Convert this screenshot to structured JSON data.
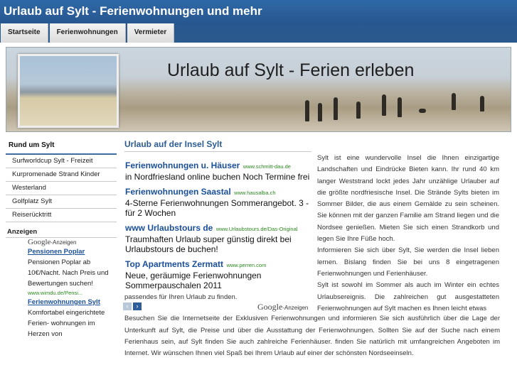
{
  "site": {
    "title": "Urlaub auf Sylt - Ferienwohnungen und mehr"
  },
  "nav": {
    "tabs": [
      "Startseite",
      "Ferienwohnungen",
      "Vermieter"
    ]
  },
  "banner": {
    "title": "Urlaub auf Sylt - Ferien erleben"
  },
  "sidebar": {
    "heading": "Rund um Sylt",
    "items": [
      "Surfworldcup Sylt - Freizeit",
      "Kurpromenade Strand Kinder",
      "Westerland",
      "Golfplatz Sylt",
      "Reiserücktritt"
    ],
    "ads_heading": "Anzeigen",
    "google_label": "-Anzeigen",
    "google_logo": "Google",
    "ads": [
      {
        "title": "Pensionen Poplar",
        "text": "Pensionen Poplar ab 10€/Nacht. Nach Preis und Bewertungen suchen!",
        "url": "www.wimdu.de/Pensi..."
      },
      {
        "title": "Ferienwohnungen Sylt",
        "text": "Komfortabel eingerichtete Ferien- wohnungen im Herzen von",
        "url": ""
      }
    ]
  },
  "main": {
    "title": "Urlaub auf der Insel Sylt",
    "ads": [
      {
        "title": "Ferienwohnungen u. Häuser",
        "url": "www.schmitt-dau.de",
        "text": "in Nordfriesland online buchen Noch Termine frei"
      },
      {
        "title": "Ferienwohnungen Saastal",
        "url": "www.hausalba.ch",
        "text": "4-Sterne Ferienwohnungen Sommerangebot. 3 - für 2 Wochen"
      },
      {
        "title": "www Urlaubstours de",
        "url": "www.Urlaubstours.de/Das-Original",
        "text": "Traumhaften Urlaub super günstig direkt bei Urlaubstours de buchen!"
      },
      {
        "title": "Top Apartments Zermatt",
        "url": "www.perren.com",
        "text": "Neue, geräumige Ferienwohnungen Sommerpauschalen 2011"
      }
    ],
    "ad_nav": {
      "prev": "‹",
      "next": "›"
    },
    "google_logo": "Google",
    "google_label": "-Anzeigen",
    "right_paragraphs": [
      "Sylt ist eine wundervolle Insel die Ihnen einzigartige Landschaften und Eindrücke Bieten kann. Ihr rund 40 km langer Weststrand lockt jedes Jahr unzählige Urlauber auf die größte nordfriesische Insel. Die Strände Sylts bieten im Sommer Bilder, die aus einem Gemälde zu sein scheinen. Sie können mit der ganzen Familie am Strand liegen und die Nordsee genießen. Mieten Sie sich einen Strandkorb und legen Sie Ihre Füße hoch.",
      "Informieren Sie sich über Sylt, Sie werden die Insel lieben lernen. Bislang finden Sie bei uns 8 eingetragenen Ferienwohnungen und Ferienhäuser.",
      "Sylt ist sowohl im Sommer als auch im Winter ein echtes Urlaubsereignis. Die zahlreichen gut ausgestatteten Ferienwohnungen auf Sylt machen es Ihnen leicht etwas"
    ],
    "bottom_lead": "passendes für Ihren Urlaub zu finden.",
    "bottom_paragraph": "Besuchen Sie die Internetseite der Exklusiven Ferienwohnungen und informieren Sie sich ausführlich über die Lage der Unterkunft auf Sylt, die Preise und über die Ausstattung der Ferienwohnungen. Sollten Sie auf der Suche nach einem Ferienhaus sein, auf Sylt finden Sie auch zahlreiche Ferienhäuser. finden Sie natürlich mit umfangreichen Angeboten im Internet. Wir wünschen Ihnen viel Spaß bei Ihrem Urlaub auf einer der schönsten Nordseeinseln."
  }
}
